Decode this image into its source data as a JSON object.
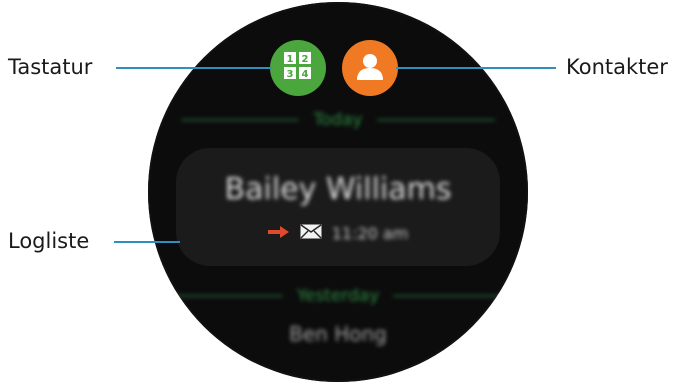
{
  "callouts": {
    "keypad": "Tastatur",
    "contacts": "Kontakter",
    "log_list": "Logliste"
  },
  "watch": {
    "buttons": {
      "keypad_icon": "keypad-icon",
      "contacts_icon": "person-icon"
    },
    "sections": [
      {
        "label": "Today"
      },
      {
        "label": "Yesterday"
      }
    ],
    "entries": [
      {
        "name": "Bailey Williams",
        "time": "11:20 am",
        "direction": "outgoing",
        "type": "message"
      },
      {
        "name": "Ben Hong"
      }
    ]
  },
  "colors": {
    "keypad_bg": "#4aa63d",
    "contacts_bg": "#f07a24",
    "callout_line": "#2f8fbf",
    "section_green": "#2f8a44",
    "arrow_red": "#e04a2c"
  }
}
